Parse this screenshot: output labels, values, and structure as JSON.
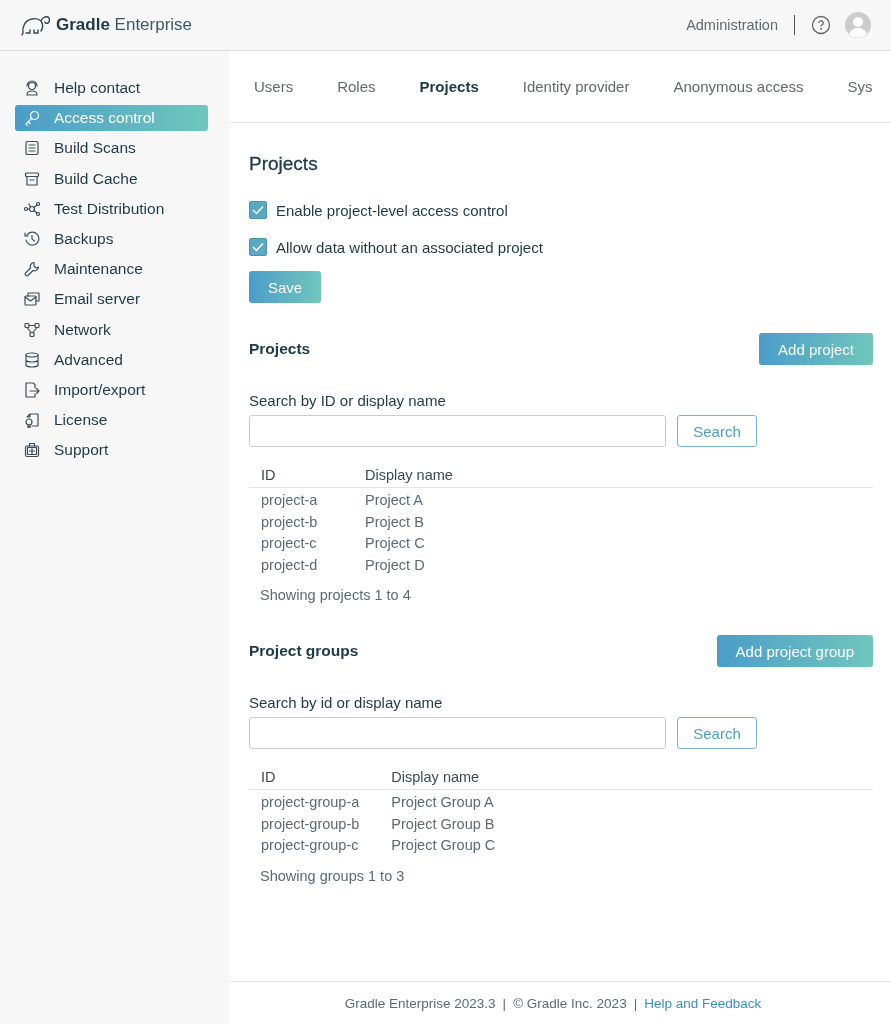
{
  "header": {
    "logo_bold": "Gradle",
    "logo_light": "Enterprise",
    "nav_link": "Administration"
  },
  "sidebar": {
    "items": [
      {
        "label": "Help contact",
        "selected": false
      },
      {
        "label": "Access control",
        "selected": true
      },
      {
        "label": "Build Scans",
        "selected": false
      },
      {
        "label": "Build Cache",
        "selected": false
      },
      {
        "label": "Test Distribution",
        "selected": false
      },
      {
        "label": "Backups",
        "selected": false
      },
      {
        "label": "Maintenance",
        "selected": false
      },
      {
        "label": "Email server",
        "selected": false
      },
      {
        "label": "Network",
        "selected": false
      },
      {
        "label": "Advanced",
        "selected": false
      },
      {
        "label": "Import/export",
        "selected": false
      },
      {
        "label": "License",
        "selected": false
      },
      {
        "label": "Support",
        "selected": false
      }
    ]
  },
  "tabs": [
    {
      "label": "Users",
      "selected": false
    },
    {
      "label": "Roles",
      "selected": false
    },
    {
      "label": "Projects",
      "selected": true
    },
    {
      "label": "Identity provider",
      "selected": false
    },
    {
      "label": "Anonymous access",
      "selected": false
    },
    {
      "label": "Sys",
      "selected": false
    }
  ],
  "settings": {
    "title": "Projects",
    "checkboxes": [
      {
        "label": "Enable project-level access control",
        "checked": true
      },
      {
        "label": "Allow data without an associated project",
        "checked": true
      }
    ],
    "save_button": "Save"
  },
  "sections": [
    {
      "title": "Projects",
      "add_button": "Add project",
      "search_label": "Search by ID or display name",
      "search_button": "Search",
      "columns": [
        "ID",
        "Display name"
      ],
      "rows": [
        [
          "project-a",
          "Project A"
        ],
        [
          "project-b",
          "Project B"
        ],
        [
          "project-c",
          "Project C"
        ],
        [
          "project-d",
          "Project D"
        ]
      ],
      "summary": "Showing projects 1 to 4"
    },
    {
      "title": "Project groups",
      "add_button": "Add project group",
      "search_label": "Search by id or display name",
      "search_button": "Search",
      "columns": [
        "ID",
        "Display name"
      ],
      "rows": [
        [
          "project-group-a",
          "Project Group A"
        ],
        [
          "project-group-b",
          "Project Group B"
        ],
        [
          "project-group-c",
          "Project Group C"
        ]
      ],
      "summary": "Showing groups 1 to 3"
    }
  ],
  "footer": {
    "parts": [
      {
        "kind": "text",
        "text": "Gradle Enterprise 2023.3"
      },
      {
        "kind": "separator",
        "text": "|"
      },
      {
        "kind": "text",
        "text": "© Gradle Inc. 2023"
      },
      {
        "kind": "separator",
        "text": "|"
      },
      {
        "kind": "link",
        "text": "Help and Feedback"
      }
    ]
  }
}
